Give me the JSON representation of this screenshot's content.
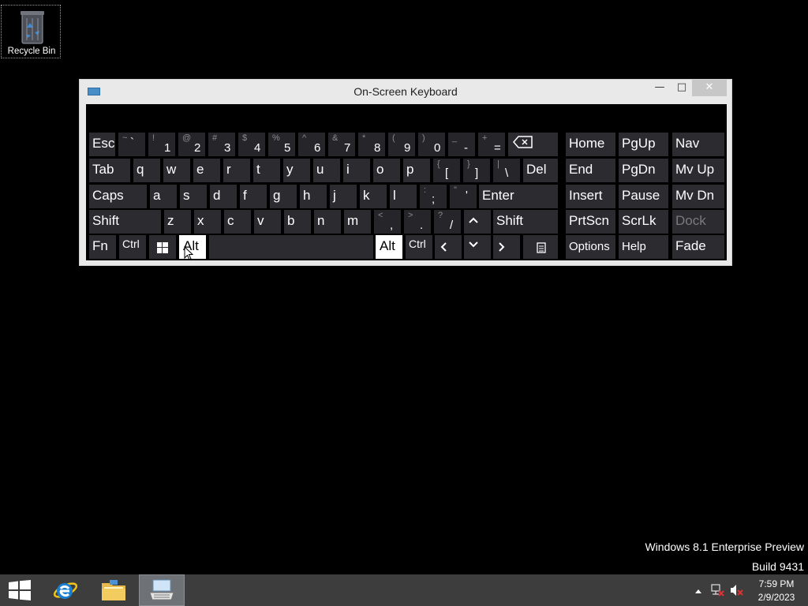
{
  "desktop": {
    "recycle_bin_label": "Recycle Bin"
  },
  "osk": {
    "title": "On-Screen Keyboard",
    "keys": {
      "esc": "Esc",
      "grave_top": "~",
      "grave_bot": "`",
      "n1_top": "!",
      "n1_bot": "1",
      "n2_top": "@",
      "n2_bot": "2",
      "n3_top": "#",
      "n3_bot": "3",
      "n4_top": "$",
      "n4_bot": "4",
      "n5_top": "%",
      "n5_bot": "5",
      "n6_top": "^",
      "n6_bot": "6",
      "n7_top": "&",
      "n7_bot": "7",
      "n8_top": "*",
      "n8_bot": "8",
      "n9_top": "(",
      "n9_bot": "9",
      "n0_top": ")",
      "n0_bot": "0",
      "minus_top": "_",
      "minus_bot": "-",
      "equals_top": "+",
      "equals_bot": "=",
      "home": "Home",
      "pgup": "PgUp",
      "nav": "Nav",
      "tab": "Tab",
      "q": "q",
      "w": "w",
      "e": "e",
      "r": "r",
      "t": "t",
      "y": "y",
      "u": "u",
      "i": "i",
      "o": "o",
      "p": "p",
      "lbracket_top": "{",
      "lbracket_bot": "[",
      "rbracket_top": "}",
      "rbracket_bot": "]",
      "backslash_top": "|",
      "backslash_bot": "\\",
      "del": "Del",
      "end": "End",
      "pgdn": "PgDn",
      "mvup": "Mv Up",
      "caps": "Caps",
      "a": "a",
      "s": "s",
      "d": "d",
      "f": "f",
      "g": "g",
      "h": "h",
      "j": "j",
      "k": "k",
      "l": "l",
      "semi_top": ":",
      "semi_bot": ";",
      "quote_top": "\"",
      "quote_bot": "'",
      "enter": "Enter",
      "insert": "Insert",
      "pause": "Pause",
      "mvdn": "Mv Dn",
      "shift_left": "Shift",
      "z": "z",
      "x": "x",
      "c": "c",
      "v": "v",
      "b": "b",
      "n": "n",
      "m": "m",
      "comma_top": "<",
      "comma_bot": ",",
      "period_top": ">",
      "period_bot": ".",
      "slash_top": "?",
      "slash_bot": "/",
      "shift_right": "Shift",
      "prtscn": "PrtScn",
      "scrlk": "ScrLk",
      "dock": "Dock",
      "fn": "Fn",
      "ctrl_left": "Ctrl",
      "alt_left": "Alt",
      "alt_right": "Alt",
      "ctrl_right": "Ctrl",
      "options": "Options",
      "help": "Help",
      "fade": "Fade"
    }
  },
  "watermark": {
    "line1": "Windows 8.1 Enterprise Preview",
    "line2": "Build 9431"
  },
  "taskbar": {
    "clock_time": "7:59 PM",
    "clock_date": "2/9/2023"
  },
  "colors": {
    "key_bg": "#2b2b30",
    "highlight_key": "#ffffff",
    "taskbar": "#3d3d3d",
    "window_chrome": "#e9e9e9"
  }
}
